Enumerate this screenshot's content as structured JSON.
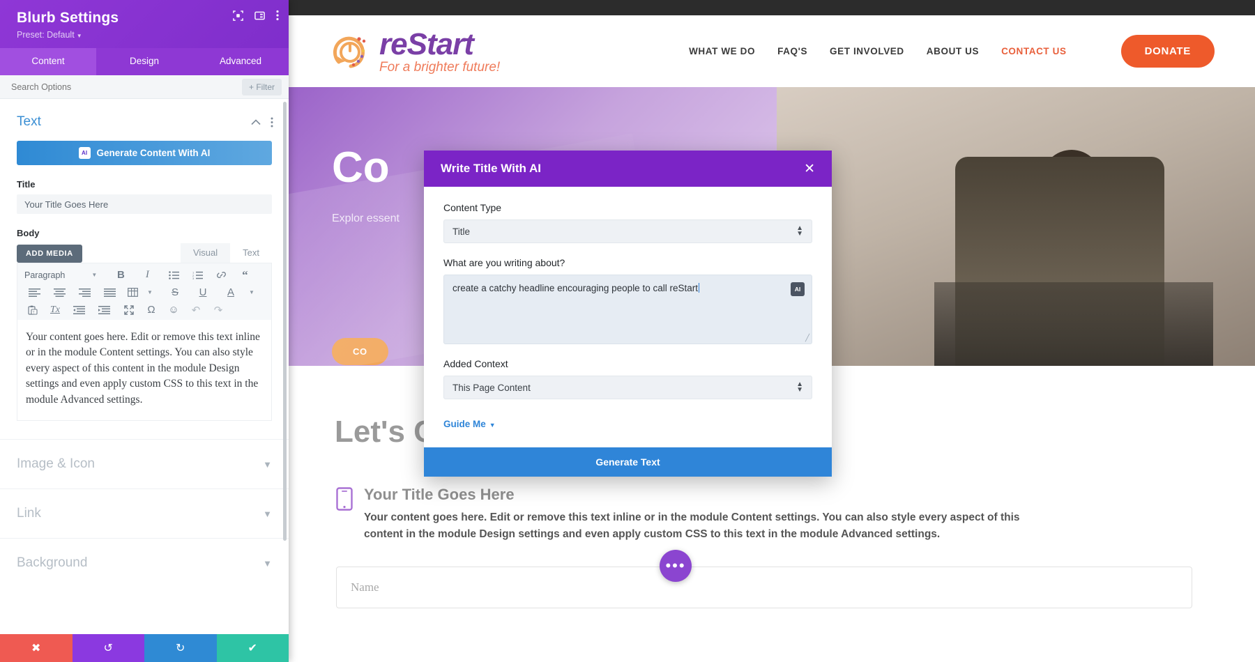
{
  "settings_panel": {
    "title": "Blurb Settings",
    "preset": "Preset: Default",
    "header_icons": [
      {
        "name": "focus-icon"
      },
      {
        "name": "layout-columns-icon"
      },
      {
        "name": "more-vertical-icon"
      }
    ],
    "tabs": [
      {
        "label": "Content",
        "active": true
      },
      {
        "label": "Design",
        "active": false
      },
      {
        "label": "Advanced",
        "active": false
      }
    ],
    "search_placeholder": "Search Options",
    "filter_label": "+ Filter",
    "section": {
      "title": "Text",
      "ai_button": "Generate Content With AI",
      "ai_badge": "AI"
    },
    "title_field": {
      "label": "Title",
      "value": "Your Title Goes Here"
    },
    "body_field": {
      "label": "Body",
      "add_media": "ADD MEDIA",
      "modes": [
        {
          "label": "Visual",
          "active": true
        },
        {
          "label": "Text",
          "active": false
        }
      ],
      "toolbar_row1": [
        {
          "name": "paragraph-format-select",
          "label": "Paragraph"
        },
        {
          "name": "bold-icon",
          "label": "B"
        },
        {
          "name": "italic-icon",
          "label": "I"
        },
        {
          "name": "bulleted-list-icon",
          "label": "☰"
        },
        {
          "name": "numbered-list-icon",
          "label": "≡"
        },
        {
          "name": "link-icon",
          "label": "🔗"
        },
        {
          "name": "blockquote-icon",
          "label": "“"
        }
      ],
      "toolbar_row2": [
        {
          "name": "align-left-icon",
          "label": "≡"
        },
        {
          "name": "align-center-icon",
          "label": "≡"
        },
        {
          "name": "align-right-icon",
          "label": "≡"
        },
        {
          "name": "align-justify-icon",
          "label": "≡"
        },
        {
          "name": "table-icon",
          "label": "⊞"
        },
        {
          "name": "strikethrough-icon",
          "label": "S"
        },
        {
          "name": "underline-icon",
          "label": "U"
        },
        {
          "name": "text-color-icon",
          "label": "A"
        }
      ],
      "toolbar_row3": [
        {
          "name": "paste-as-text-icon",
          "label": "📋"
        },
        {
          "name": "clear-formatting-icon",
          "label": "Tx"
        },
        {
          "name": "outdent-icon",
          "label": "≡"
        },
        {
          "name": "indent-icon",
          "label": "≡"
        },
        {
          "name": "fullscreen-icon",
          "label": "⤡"
        },
        {
          "name": "special-character-icon",
          "label": "Ω"
        },
        {
          "name": "emoji-icon",
          "label": "☺"
        },
        {
          "name": "undo-icon",
          "label": "↶"
        },
        {
          "name": "redo-icon",
          "label": "↷"
        }
      ],
      "content": "Your content goes here. Edit or remove this text inline or in the module Content settings. You can also style every aspect of this content in the module Design settings and even apply custom CSS to this text in the module Advanced settings."
    },
    "accordions": [
      {
        "label": "Image & Icon"
      },
      {
        "label": "Link"
      },
      {
        "label": "Background"
      }
    ],
    "footer_buttons": [
      {
        "name": "discard-changes-button",
        "icon": "✖",
        "color": "#ef5a52"
      },
      {
        "name": "undo-button",
        "icon": "↺",
        "color": "#8b39e0"
      },
      {
        "name": "redo-button",
        "icon": "↻",
        "color": "#2f8ad4"
      },
      {
        "name": "save-changes-button",
        "icon": "✔",
        "color": "#2ec4a5"
      }
    ]
  },
  "site": {
    "logo": {
      "main": "reStart",
      "sub": "For a brighter future!"
    },
    "nav": [
      {
        "label": "WHAT WE DO",
        "accent": false
      },
      {
        "label": "FAQ'S",
        "accent": false
      },
      {
        "label": "GET INVOLVED",
        "accent": false
      },
      {
        "label": "ABOUT US",
        "accent": false
      },
      {
        "label": "CONTACT US",
        "accent": true
      }
    ],
    "donate_label": "DONATE",
    "hero": {
      "heading": "Co",
      "paragraph": "Explor essent",
      "cta": "CO",
      "add_button": "+"
    },
    "section_heading": "Let's Connect",
    "blurb": {
      "icon": "phone-icon",
      "title": "Your Title Goes Here",
      "text": "Your content goes here. Edit or remove this text inline or in the module Content settings. You can also style every aspect of this content in the module Design settings and even apply custom CSS to this text in the module Advanced settings."
    },
    "name_placeholder": "Name",
    "fab_label": "•••"
  },
  "ai_modal": {
    "title": "Write Title With AI",
    "close_icon": "✕",
    "content_type": {
      "label": "Content Type",
      "value": "Title"
    },
    "prompt": {
      "label": "What are you writing about?",
      "value": "create a catchy headline encouraging people to call reStart",
      "badge": "AI"
    },
    "added_context": {
      "label": "Added Context",
      "value": "This Page Content"
    },
    "guide_me": "Guide Me",
    "generate_button": "Generate Text"
  },
  "colors": {
    "panel_purple": "#8f37d6",
    "modal_purple": "#7b24c6",
    "blue": "#2f85d8",
    "orange": "#ee5a2b",
    "teal": "#2ec4a5",
    "red": "#ef5a52"
  }
}
